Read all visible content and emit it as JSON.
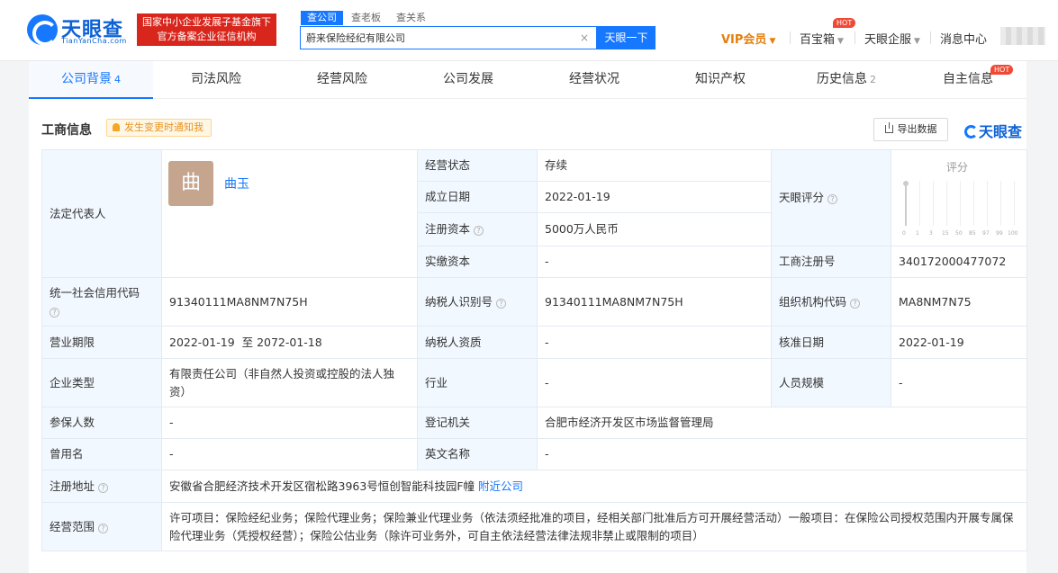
{
  "header": {
    "logo_text": "天眼查",
    "logo_sub": "TianYanCha.com",
    "gov_badge_line1": "国家中小企业发展子基金旗下",
    "gov_badge_line2": "官方备案企业征信机构",
    "search_tabs": [
      "查公司",
      "查老板",
      "查关系"
    ],
    "search_value": "蔚来保险经纪有限公司",
    "search_clear": "×",
    "search_button": "天眼一下",
    "vip_label": "VIP会员",
    "baibaoxiang": "百宝箱",
    "hot": "HOT",
    "tianyan_qifu": "天眼企服",
    "message_center": "消息中心"
  },
  "tabs": [
    {
      "label": "公司背景",
      "count": "4"
    },
    {
      "label": "司法风险",
      "count": ""
    },
    {
      "label": "经营风险",
      "count": ""
    },
    {
      "label": "公司发展",
      "count": ""
    },
    {
      "label": "经营状况",
      "count": ""
    },
    {
      "label": "知识产权",
      "count": ""
    },
    {
      "label": "历史信息",
      "count": "2"
    },
    {
      "label": "自主信息",
      "count": ""
    }
  ],
  "section": {
    "title": "工商信息",
    "notify_label": "发生变更时通知我",
    "export_label": "导出数据",
    "brand": "天眼查"
  },
  "company": {
    "legal_rep_label": "法定代表人",
    "legal_rep_avatar_char": "曲",
    "legal_rep_name": "曲玉",
    "status_label": "经营状态",
    "status_value": "存续",
    "founded_label": "成立日期",
    "founded_value": "2022-01-19",
    "reg_capital_label": "注册资本",
    "reg_capital_value": "5000万人民币",
    "paid_capital_label": "实缴资本",
    "paid_capital_value": "-",
    "tianyan_score_label": "天眼评分",
    "score_title": "评分",
    "score_ticks": [
      "0",
      "1",
      "3",
      "15",
      "50",
      "85",
      "97",
      "99",
      "100"
    ],
    "biz_reg_no_label": "工商注册号",
    "biz_reg_no_value": "340172000477072",
    "credit_code_label": "统一社会信用代码",
    "credit_code_value": "91340111MA8NM7N75H",
    "taxpayer_id_label": "纳税人识别号",
    "taxpayer_id_value": "91340111MA8NM7N75H",
    "org_code_label": "组织机构代码",
    "org_code_value": "MA8NM7N75",
    "term_label": "营业期限",
    "term_value": "2022-01-19  至 2072-01-18",
    "taxpayer_qual_label": "纳税人资质",
    "taxpayer_qual_value": "-",
    "approval_date_label": "核准日期",
    "approval_date_value": "2022-01-19",
    "type_label": "企业类型",
    "type_value": "有限责任公司（非自然人投资或控股的法人独资）",
    "industry_label": "行业",
    "industry_value": "-",
    "staff_size_label": "人员规模",
    "staff_size_value": "-",
    "insured_label": "参保人数",
    "insured_value": "-",
    "reg_authority_label": "登记机关",
    "reg_authority_value": "合肥市经济开发区市场监督管理局",
    "former_name_label": "曾用名",
    "former_name_value": "-",
    "english_name_label": "英文名称",
    "english_name_value": "-",
    "address_label": "注册地址",
    "address_value": "安徽省合肥经济技术开发区宿松路3963号恒创智能科技园F幢",
    "nearby_link": "附近公司",
    "scope_label": "经营范围",
    "scope_value": "许可项目：保险经纪业务；保险代理业务；保险兼业代理业务（依法须经批准的项目，经相关部门批准后方可开展经营活动）一般项目：在保险公司授权范围内开展专属保险代理业务（凭授权经营）；保险公估业务（除许可业务外，可自主依法经营法律法规非禁止或限制的项目）"
  },
  "colors": {
    "brand_blue": "#1677ff",
    "gov_red": "#d9261c",
    "vip_orange": "#e3800c",
    "label_bg": "#f2f8ff"
  }
}
